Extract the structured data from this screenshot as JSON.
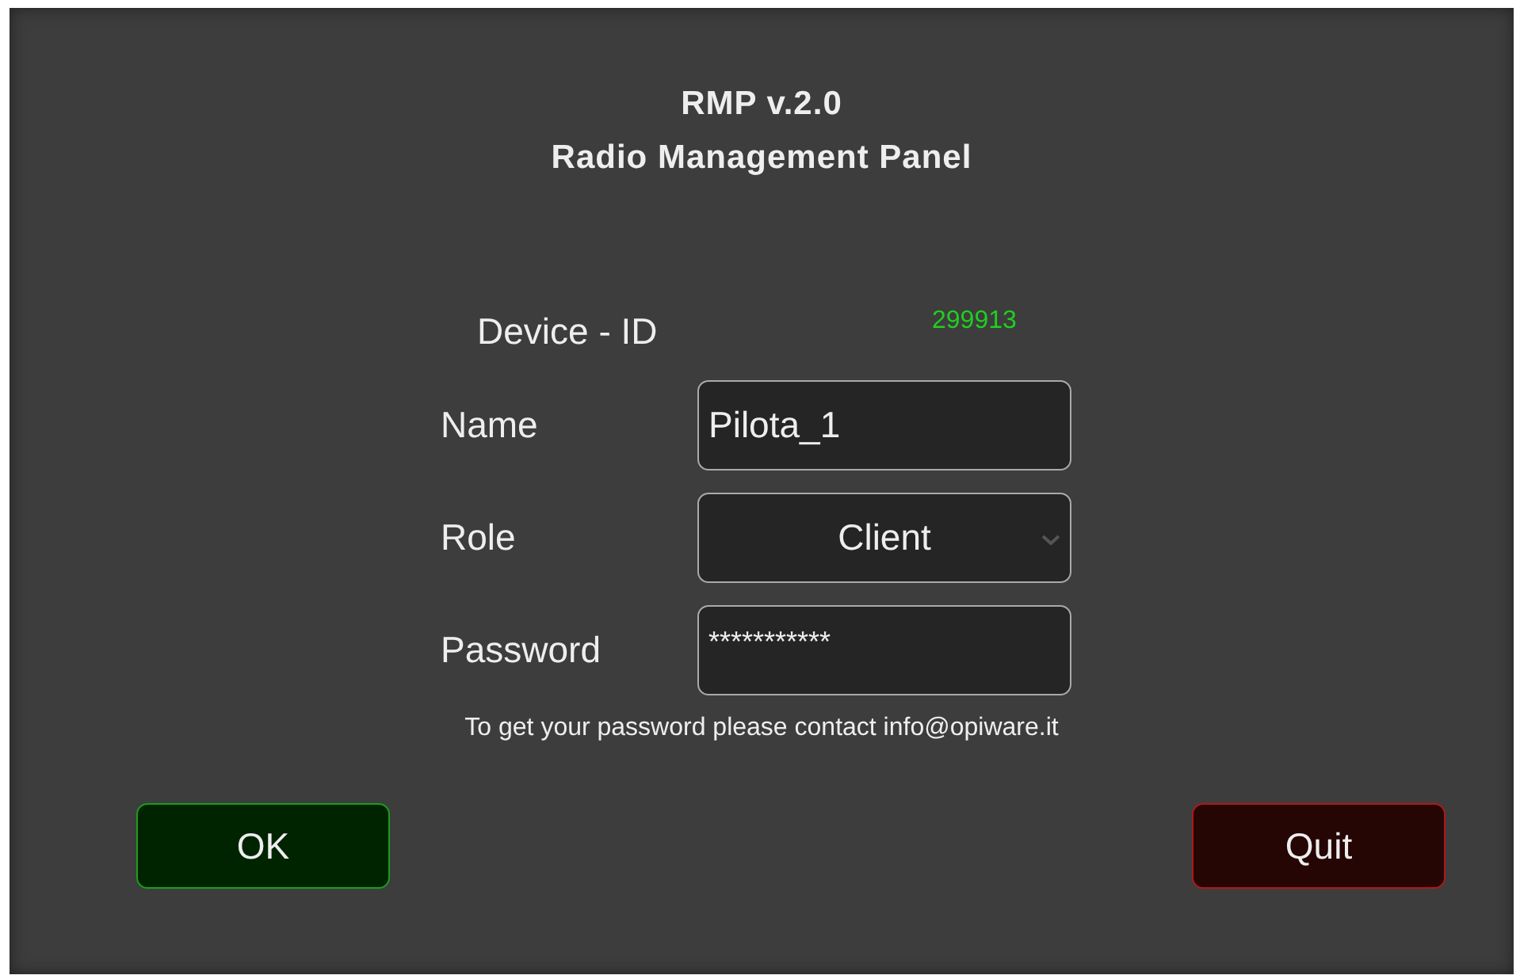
{
  "title": {
    "line_1": "RMP v.2.0",
    "line_2": "Radio Management Panel"
  },
  "device_id": {
    "label": "Device - ID",
    "value": "299913"
  },
  "fields": [
    {
      "label": "Name",
      "kind": "text",
      "value": "Pilota_1"
    },
    {
      "label": "Role",
      "kind": "select",
      "value": "Client"
    },
    {
      "label": "Password",
      "kind": "password",
      "value": "***********"
    }
  ],
  "hint": "To get your password please contact info@opiware.it",
  "buttons": [
    {
      "label": "OK",
      "kind": "confirm"
    },
    {
      "label": "Quit",
      "kind": "cancel"
    }
  ]
}
